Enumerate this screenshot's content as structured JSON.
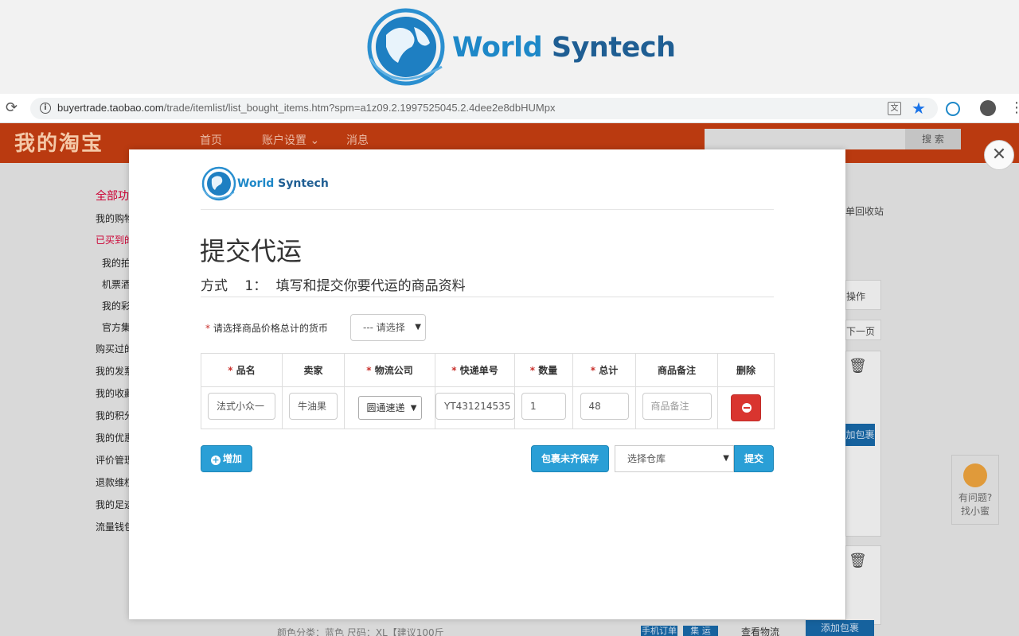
{
  "banner": {
    "logo_word1": "World",
    "logo_word2": "Syntech"
  },
  "browser": {
    "url_host": "buyertrade.taobao.com",
    "url_path": "/trade/itemlist/list_bought_items.htm?spm=a1z09.2.1997525045.2.4dee2e8dbHUMpx"
  },
  "taobao": {
    "logo": "我的淘宝",
    "nav": [
      "首页",
      "账户设置 ⌄",
      "消息"
    ],
    "search_button": "搜 索",
    "sidebar": [
      "全部功",
      "我的购物",
      "已买到的",
      "我的拍",
      "机票酒",
      "我的彩",
      "官方集",
      "购买过的",
      "我的发票",
      "我的收藏",
      "我的积分",
      "我的优惠",
      "评价管理",
      "退款维权",
      "我的足迹",
      "流量钱包"
    ],
    "right_texts": [
      "单回收站",
      "操作",
      "下一页",
      "加包裹"
    ],
    "help": {
      "line1": "有问题?",
      "line2": "找小蜜"
    },
    "bottom": {
      "desc": "颜色分类：蓝色  尺码：XL【建议100斤",
      "tag1": "手机订单",
      "tag2": "集 运",
      "logistics": "查看物流",
      "add_package": "添加包裹"
    }
  },
  "modal": {
    "logo_word1": "World",
    "logo_word2": "Syntech",
    "title": "提交代运",
    "method": {
      "label": "方式",
      "number": "1：",
      "text": "填写和提交你要代运的商品资料"
    },
    "currency": {
      "label": "请选择商品价格总计的货币",
      "value": "--- 请选择"
    },
    "table": {
      "headers": [
        "品名",
        "卖家",
        "物流公司",
        "快递单号",
        "数量",
        "总计",
        "商品备注",
        "删除"
      ],
      "required": [
        true,
        false,
        true,
        true,
        true,
        true,
        false,
        false
      ],
      "row": {
        "name": "法式小众一",
        "seller": "牛油果",
        "logistics": "圆通速递",
        "tracking": "YT431214535",
        "quantity": "1",
        "total": "48",
        "remark_placeholder": "商品备注"
      }
    },
    "buttons": {
      "add": "增加",
      "save": "包裹未齐保存",
      "warehouse": "选择仓库",
      "submit": "提交"
    }
  },
  "colors": {
    "accent": "#2a9fd6",
    "danger": "#d9352f",
    "taobao_header": "#ba3a10"
  }
}
